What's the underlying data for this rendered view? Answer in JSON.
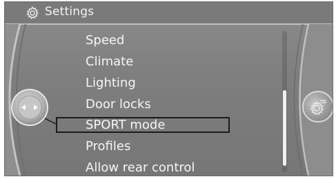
{
  "header": {
    "title": "Settings",
    "icon": "gear-icon"
  },
  "menu": {
    "items": [
      {
        "label": "Speed"
      },
      {
        "label": "Climate"
      },
      {
        "label": "Lighting"
      },
      {
        "label": "Door locks"
      },
      {
        "label": "SPORT mode"
      },
      {
        "label": "Profiles"
      },
      {
        "label": "Allow rear control"
      }
    ],
    "selected": "SPORT mode"
  },
  "controller": {
    "icon": "left-right-arrows-icon"
  },
  "options_knob": {
    "icon": "options-icon"
  },
  "colors": {
    "screen_bg": "#7e7e7e",
    "text": "#f6f6f6",
    "selection_border": "#1a1a1a"
  }
}
